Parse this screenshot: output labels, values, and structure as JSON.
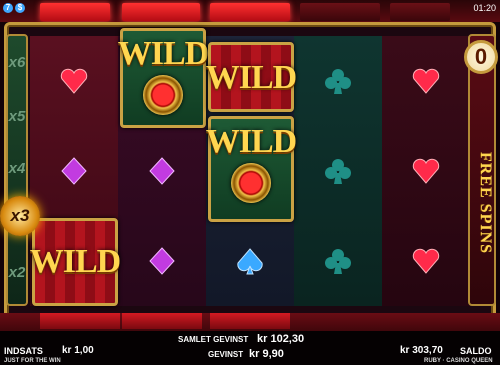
{
  "system": {
    "icons": [
      "7",
      "$"
    ],
    "clock": "01:20"
  },
  "multipliers": {
    "items": [
      "x6",
      "x5",
      "x4",
      "x2"
    ],
    "active": "x3"
  },
  "reels": {
    "wild_label": "WILD"
  },
  "free_spins": {
    "count": "0",
    "label": "FREE SPINS"
  },
  "footer": {
    "bet_label": "INDSATS",
    "bet_value": "kr 1,00",
    "bet_sub": "JUST FOR THE WIN",
    "total_win_label": "SAMLET GEVINST",
    "total_win_value": "kr 102,30",
    "win_label": "GEVINST",
    "win_value": "kr 9,90",
    "balance_value": "kr 303,70",
    "balance_label": "SALDO",
    "brand": "RUBY · CASINO QUEEN"
  },
  "colors": {
    "heart": "#ff2a4a",
    "diamond": "#c23be0",
    "spade": "#3aa9ff",
    "club": "#1f8f86",
    "gold": "#ffd650"
  }
}
